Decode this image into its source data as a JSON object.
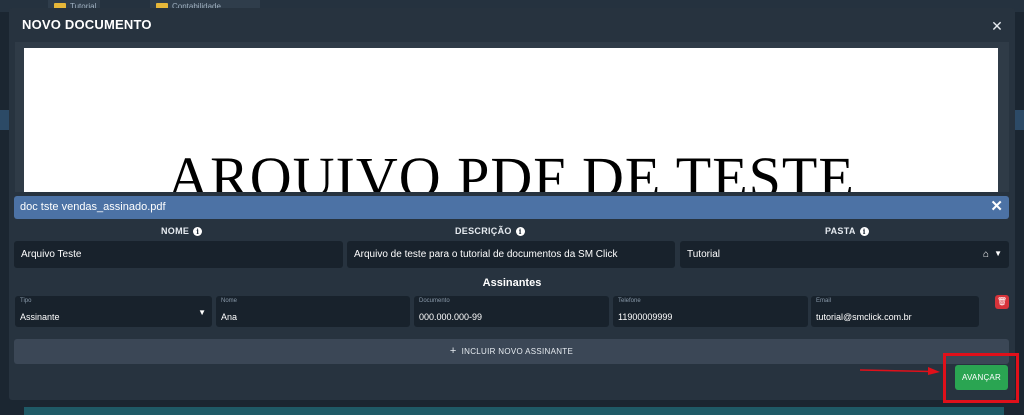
{
  "background": {
    "chips": [
      "Tutorial",
      "Contabilidade"
    ]
  },
  "modal": {
    "title": "NOVO DOCUMENTO",
    "close_icon": "close-icon"
  },
  "preview": {
    "text": "ARQUIVO PDF DE TESTE"
  },
  "file": {
    "name": "doc tste vendas_assinado.pdf"
  },
  "columns": {
    "name_label": "NOME",
    "description_label": "DESCRIÇÃO",
    "folder_label": "PASTA"
  },
  "fields": {
    "name_value": "Arquivo Teste",
    "description_value": "Arquivo de teste para o tutorial de documentos da SM Click",
    "folder_value": "Tutorial"
  },
  "signers": {
    "title": "Assinantes",
    "rows": [
      {
        "type_label": "Tipo",
        "type_value": "Assinante",
        "name_label": "Nome",
        "name_value": "Ana",
        "document_label": "Documento",
        "document_value": "000.000.000-99",
        "phone_label": "Telefone",
        "phone_value": "11900009999",
        "email_label": "Email",
        "email_value": "tutorial@smclick.com.br"
      }
    ],
    "add_label": "INCLUIR NOVO ASSINANTE"
  },
  "actions": {
    "advance_label": "AVANÇAR"
  },
  "colors": {
    "accent_blue": "#4c72a5",
    "success": "#2aa552",
    "danger": "#d6333a",
    "annotation_red": "#e0101a"
  }
}
